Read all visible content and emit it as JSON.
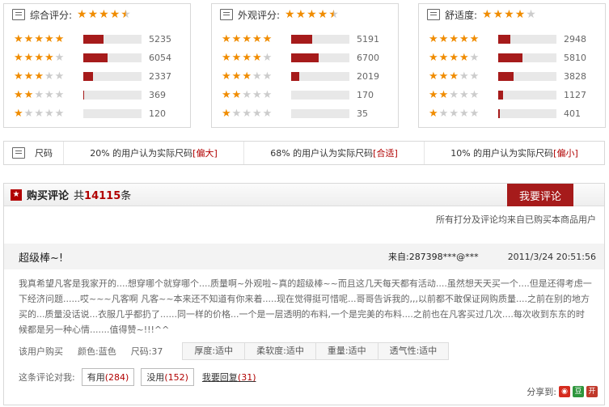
{
  "panels": [
    {
      "title": "综合评分:",
      "stars": [
        1,
        1,
        1,
        1,
        0.5
      ],
      "rows": [
        {
          "stars": 5,
          "fill": 0.35,
          "count": "5235"
        },
        {
          "stars": 4,
          "fill": 0.42,
          "count": "6054"
        },
        {
          "stars": 3,
          "fill": 0.16,
          "count": "2337"
        },
        {
          "stars": 2,
          "fill": 0.02,
          "count": "369"
        },
        {
          "stars": 1,
          "fill": 0.0,
          "count": "120"
        }
      ]
    },
    {
      "title": "外观评分:",
      "stars": [
        1,
        1,
        1,
        1,
        0.5
      ],
      "rows": [
        {
          "stars": 5,
          "fill": 0.36,
          "count": "5191"
        },
        {
          "stars": 4,
          "fill": 0.47,
          "count": "6700"
        },
        {
          "stars": 3,
          "fill": 0.14,
          "count": "2019"
        },
        {
          "stars": 2,
          "fill": 0.0,
          "count": "170"
        },
        {
          "stars": 1,
          "fill": 0.0,
          "count": "35"
        }
      ]
    },
    {
      "title": "舒适度:",
      "stars": [
        1,
        1,
        1,
        1,
        0
      ],
      "rows": [
        {
          "stars": 5,
          "fill": 0.21,
          "count": "2948"
        },
        {
          "stars": 4,
          "fill": 0.41,
          "count": "5810"
        },
        {
          "stars": 3,
          "fill": 0.27,
          "count": "3828"
        },
        {
          "stars": 2,
          "fill": 0.08,
          "count": "1127"
        },
        {
          "stars": 1,
          "fill": 0.03,
          "count": "401"
        }
      ]
    }
  ],
  "size": {
    "label": "尺码",
    "items": [
      {
        "text": "20% 的用户认为实际尺码",
        "tag": "[偏大]"
      },
      {
        "text": "68% 的用户认为实际尺码",
        "tag": "[合适]"
      },
      {
        "text": "10% 的用户认为实际尺码",
        "tag": "[偏小]"
      }
    ]
  },
  "reviews": {
    "title": "购买评论",
    "count_prefix": "共",
    "count": "14115",
    "count_suffix": "条",
    "write_btn": "我要评论",
    "note": "所有打分及评论均来自已购买本商品用户",
    "item": {
      "title": "超级棒~!",
      "from": "来自:287398***@***",
      "date": "2011/3/24 20:51:56",
      "text": "我真希望凡客是我家开的....想穿哪个就穿哪个....质量啊~外观啦~真的超级棒~~而且这几天每天都有活动....虽然想天天买一个....但是还得考虑一下经济问题......哎~~~凡客啊 凡客~~本来还不知道有你来着.....现在觉得挺可惜呢...哥哥告诉我的,,,以前都不敢保证网购质量....之前在别的地方买的...质量没话说...衣服几乎都扔了......同一样的价格...一个是一层透明的布料,一个是完美的布料....之前也在凡客买过几次....每次收到东东的时候都是另一种心情.......值得赞~!!!^^",
      "buyer": "该用户购买",
      "color": "颜色:蓝色",
      "size": "尺码:37",
      "attrs": [
        "厚度:适中",
        "柔软度:适中",
        "重量:适中",
        "透气性:适中"
      ],
      "vote_label": "这条评论对我:",
      "useful": "有用",
      "useful_count": "(284)",
      "useless": "没用",
      "useless_count": "(152)",
      "reply": "我要回复",
      "reply_count": "(31)",
      "share": "分享到:"
    }
  },
  "colors": {
    "accent": "#a61b1b",
    "star": "#f08c00"
  }
}
